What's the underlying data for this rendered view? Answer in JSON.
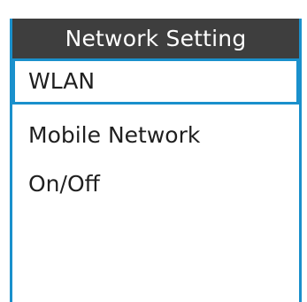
{
  "window": {
    "title": "Network Setting"
  },
  "menu": {
    "items": [
      {
        "label": "WLAN",
        "selected": true
      },
      {
        "label": "Mobile Network",
        "selected": false
      },
      {
        "label": "On/Off",
        "selected": false
      }
    ]
  },
  "colors": {
    "accent": "#1a90cc",
    "title_bar_bg": "#3e3e3e",
    "title_text": "#ffffff",
    "item_text": "#1f1f1f"
  }
}
